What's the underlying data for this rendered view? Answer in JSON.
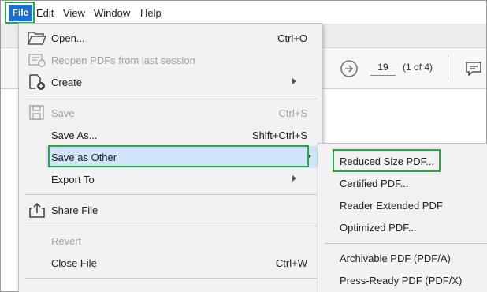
{
  "menubar": {
    "items": [
      {
        "label": "File"
      },
      {
        "label": "Edit"
      },
      {
        "label": "View"
      },
      {
        "label": "Window"
      },
      {
        "label": "Help"
      }
    ]
  },
  "toolbar": {
    "page_number": "19",
    "page_of": "(1 of 4)"
  },
  "file_menu": {
    "open": {
      "label": "Open...",
      "shortcut": "Ctrl+O"
    },
    "reopen": {
      "label": "Reopen PDFs from last session"
    },
    "create": {
      "label": "Create"
    },
    "save": {
      "label": "Save",
      "shortcut": "Ctrl+S"
    },
    "save_as": {
      "label": "Save As...",
      "shortcut": "Shift+Ctrl+S"
    },
    "save_as_other": {
      "label": "Save as Other"
    },
    "export_to": {
      "label": "Export To"
    },
    "share_file": {
      "label": "Share File"
    },
    "revert": {
      "label": "Revert"
    },
    "close_file": {
      "label": "Close File",
      "shortcut": "Ctrl+W"
    }
  },
  "submenu": {
    "items": [
      {
        "label": "Reduced Size PDF..."
      },
      {
        "label": "Certified PDF..."
      },
      {
        "label": "Reader Extended PDF"
      },
      {
        "label": "Optimized PDF..."
      },
      {
        "label": "Archivable PDF (PDF/A)"
      },
      {
        "label": "Press-Ready PDF (PDF/X)"
      }
    ]
  },
  "colors": {
    "highlight_box": "#29a845",
    "file_button": "#1f6fd0",
    "hover_row": "#cfe4f7"
  }
}
